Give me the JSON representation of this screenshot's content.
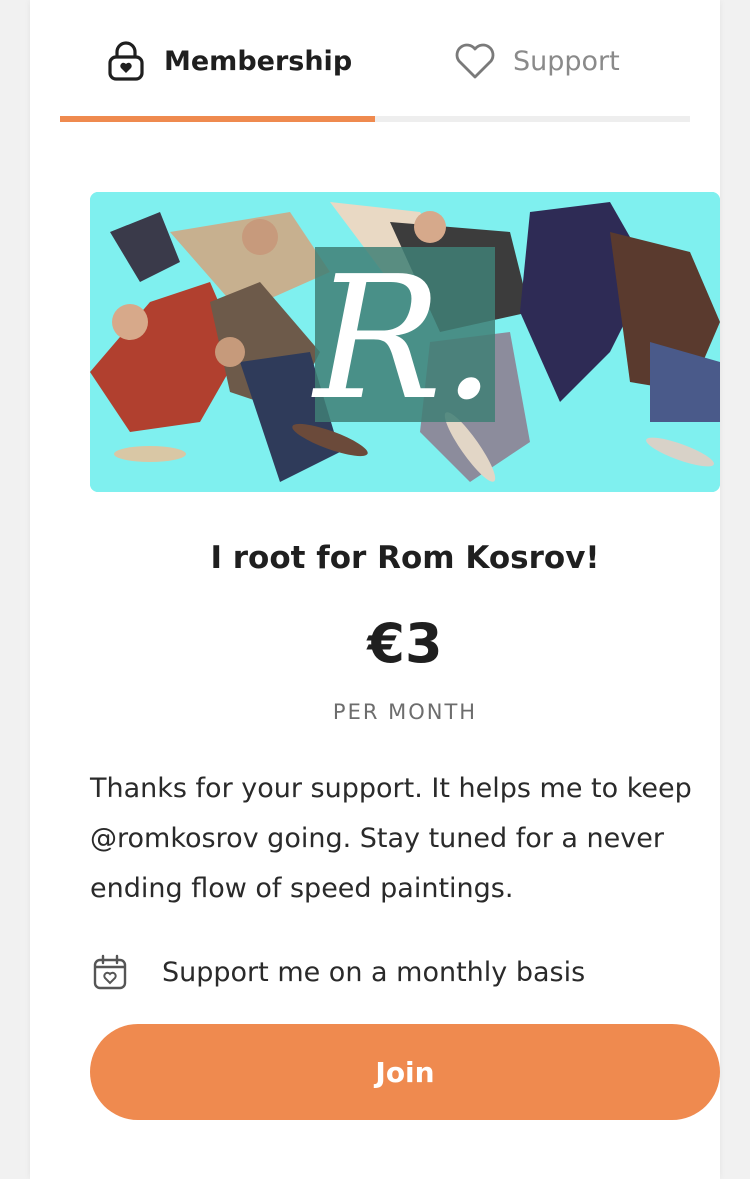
{
  "tabs": {
    "membership": {
      "label": "Membership",
      "icon": "lock-heart-icon",
      "active": true
    },
    "support": {
      "label": "Support",
      "icon": "heart-icon",
      "active": false
    }
  },
  "colors": {
    "accent": "#ef8a4f",
    "banner_bg": "#7ff0ef",
    "text": "#1f1f1f",
    "muted": "#6d6d6d"
  },
  "tier": {
    "banner_logo_letter": "R.",
    "title": "I root for Rom Kosrov!",
    "price": "€3",
    "period": "PER MONTH",
    "description": "Thanks for your support. It helps me to keep @romkosrov going. Stay tuned for a never ending flow of speed paintings.",
    "benefit": {
      "icon": "calendar-heart-icon",
      "text": "Support me on a monthly basis"
    },
    "join_label": "Join"
  }
}
